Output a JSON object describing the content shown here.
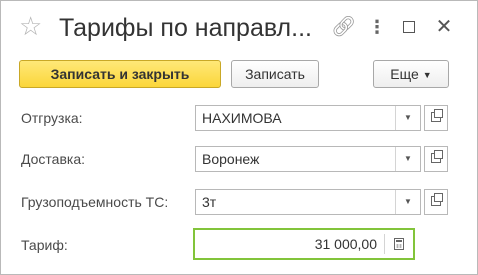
{
  "window": {
    "title": "Тарифы по направл...",
    "icons": [
      "star-icon",
      "link-icon",
      "more-icon",
      "maximize-icon",
      "close-icon"
    ]
  },
  "toolbar": {
    "primary_label": "Записать и закрыть",
    "save_label": "Записать",
    "more_label": "Еще"
  },
  "form": {
    "shipment": {
      "label": "Отгрузка:",
      "value": "НАХИМОВА"
    },
    "delivery": {
      "label": "Доставка:",
      "value": "Воронеж"
    },
    "capacity": {
      "label": "Грузоподъемность ТС:",
      "value": "3т"
    },
    "tariff": {
      "label": "Тариф:",
      "value": "31 000,00"
    }
  },
  "colors": {
    "primary_button": "#fbd63a",
    "focus_border": "#82c43a"
  }
}
